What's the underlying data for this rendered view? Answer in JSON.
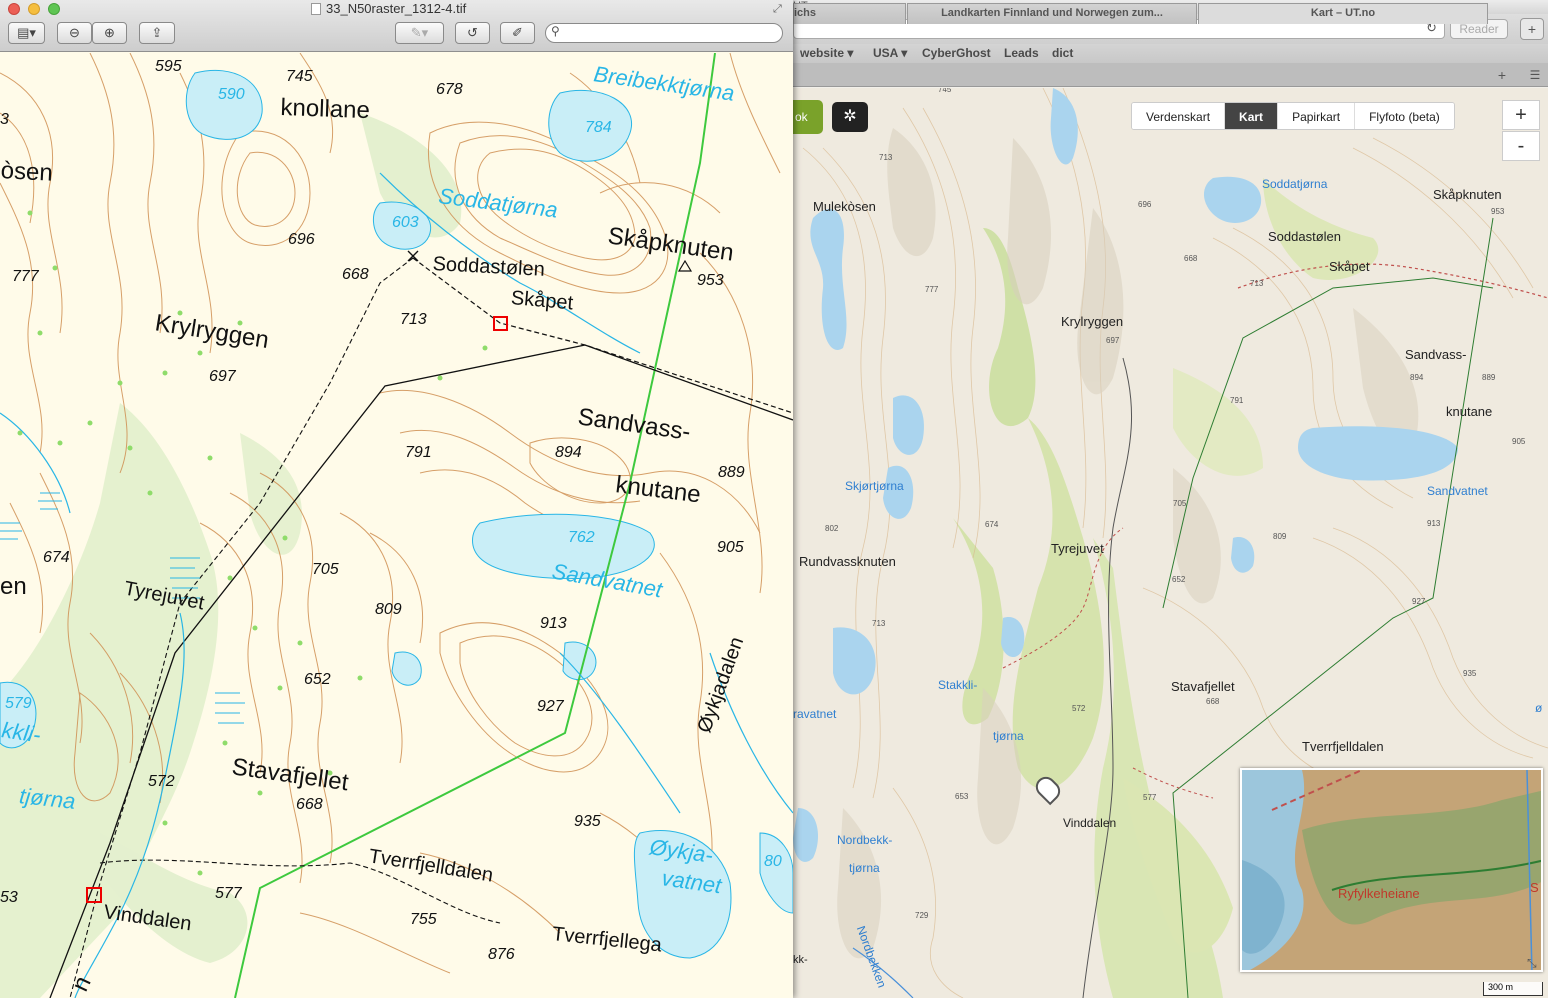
{
  "browser": {
    "title": "UT.no",
    "reader_label": "Reader",
    "bookmarks": [
      "website ▾",
      "USA ▾",
      "CyberGhost",
      "Leads",
      "dict"
    ],
    "tabs": [
      {
        "label": "ichs"
      },
      {
        "label": "Landkarten Finnland und Norwegen zum..."
      },
      {
        "label": "Kart – UT.no"
      }
    ],
    "map_modes": [
      "Verdenskart",
      "Kart",
      "Papirkart",
      "Flyfoto (beta)"
    ],
    "active_mode": "Kart",
    "zoom_in": "+",
    "zoom_out": "-",
    "left_btn_text": "ok",
    "minimap_label": "Ryfylkeheiane",
    "minimap_edge_label": "S",
    "scale_label": "300 m",
    "map_labels": [
      "Mulekòsen",
      "Soddatjørna",
      "Skåpknuten",
      "Soddastølen",
      "Skåpet",
      "Krylryggen",
      "Sandvass-",
      "knutane",
      "Skjørtjørna",
      "Sandvatnet",
      "Tyrejuvet",
      "Rundvassknuten",
      "Stakkli-",
      "tjørna",
      "Stavafjellet",
      "Tverrfjelldalen",
      "Nordbekk-",
      "tjørna",
      "Vinddalen",
      "ravatnet",
      "Nordbekken",
      "kk-",
      "ø"
    ],
    "heights": [
      "745",
      "713",
      "696",
      "953",
      "668",
      "713",
      "777",
      "697",
      "791",
      "894",
      "889",
      "905",
      "705",
      "674",
      "809",
      "913",
      "652",
      "802",
      "713",
      "927",
      "935",
      "572",
      "668",
      "653",
      "577",
      "729"
    ]
  },
  "preview": {
    "title": "33_N50raster_1312-4.tif",
    "labels": {
      "knollane": "knollane",
      "osen": "òsen",
      "breibekk": "Breibekktjørna",
      "soddatjorna": "Soddatjørna",
      "skapknuten": "Skåpknuten",
      "soddastolen": "Soddastølen",
      "skapet": "Skåpet",
      "krylryggen": "Krylryggen",
      "sandvass": "Sandvass-",
      "knutane": "knutane",
      "sandvatnet": "Sandvatnet",
      "tyrejuvet": "Tyrejuvet",
      "en": "en",
      "oykjadalen": "Øykjadalen",
      "stavafjellet": "Stavafjellet",
      "oykja": "Øykja-",
      "vatnet": "vatnet",
      "tverrfjelldalen": "Tverrfjelldalen",
      "vinddalen": "Vinddalen",
      "tverrfjellega": "Tverrfjellega",
      "kkli": "kkli-",
      "tjorna": "tjørna",
      "n": "n"
    },
    "heights": [
      "595",
      "745",
      "678",
      "3",
      "696",
      "668",
      "777",
      "713",
      "953",
      "697",
      "791",
      "894",
      "889",
      "905",
      "674",
      "705",
      "809",
      "913",
      "652",
      "927",
      "572",
      "668",
      "935",
      "577",
      "755",
      "876",
      "53"
    ],
    "water_heights": [
      "590",
      "784",
      "603",
      "762",
      "579",
      "80"
    ]
  }
}
